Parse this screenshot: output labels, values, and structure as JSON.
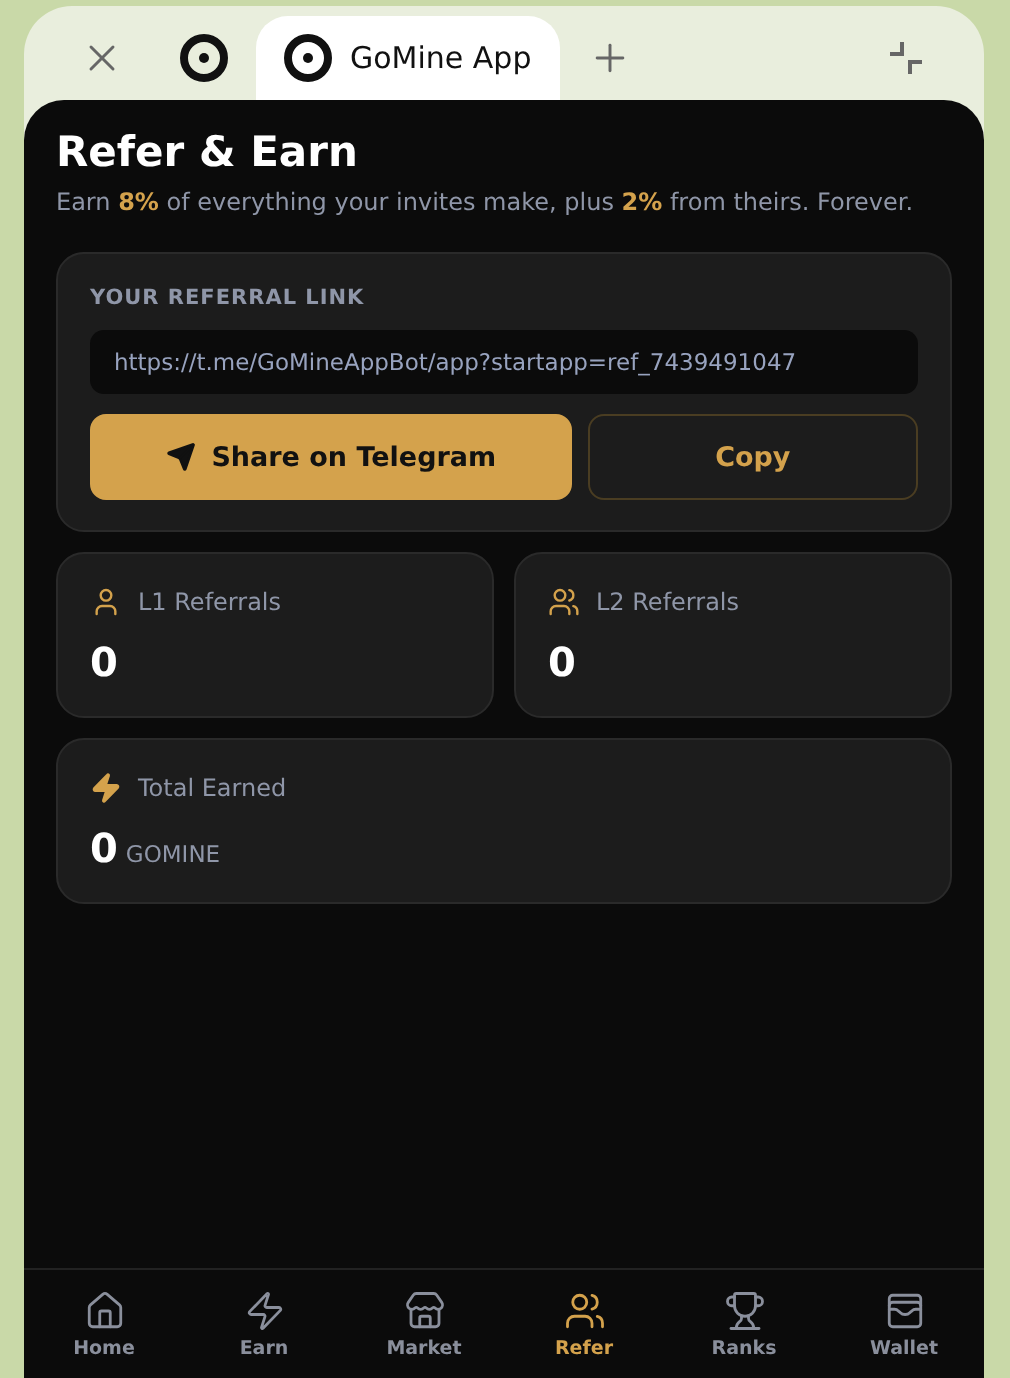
{
  "browser": {
    "tabs": [
      {
        "selected": false
      },
      {
        "label": "GoMine App",
        "selected": true
      }
    ]
  },
  "header": {
    "title": "Refer & Earn",
    "subtitle": "Earn **8%** of everything your invites make, plus **2%** from theirs. Forever."
  },
  "referral": {
    "label": "YOUR REFERRAL LINK",
    "link": "https://t.me/GoMineAppBot/app?startapp=ref_7439491047",
    "buttons": [
      {
        "label": "Share on Telegram",
        "kind": "primary"
      },
      {
        "label": "Copy",
        "kind": "outline"
      }
    ]
  },
  "stats": [
    {
      "label": "L1 Referrals",
      "value": "0"
    },
    {
      "label": "L2 Referrals",
      "value": "0"
    }
  ],
  "total": {
    "label": "Total Earned",
    "value": "0",
    "unit": "GOMINE"
  },
  "nav": [
    {
      "label": "Home",
      "selected": false
    },
    {
      "label": "Earn",
      "selected": false
    },
    {
      "label": "Market",
      "selected": false
    },
    {
      "label": "Refer",
      "selected": true
    },
    {
      "label": "Ranks",
      "selected": false
    },
    {
      "label": "Wallet",
      "selected": false
    }
  ]
}
